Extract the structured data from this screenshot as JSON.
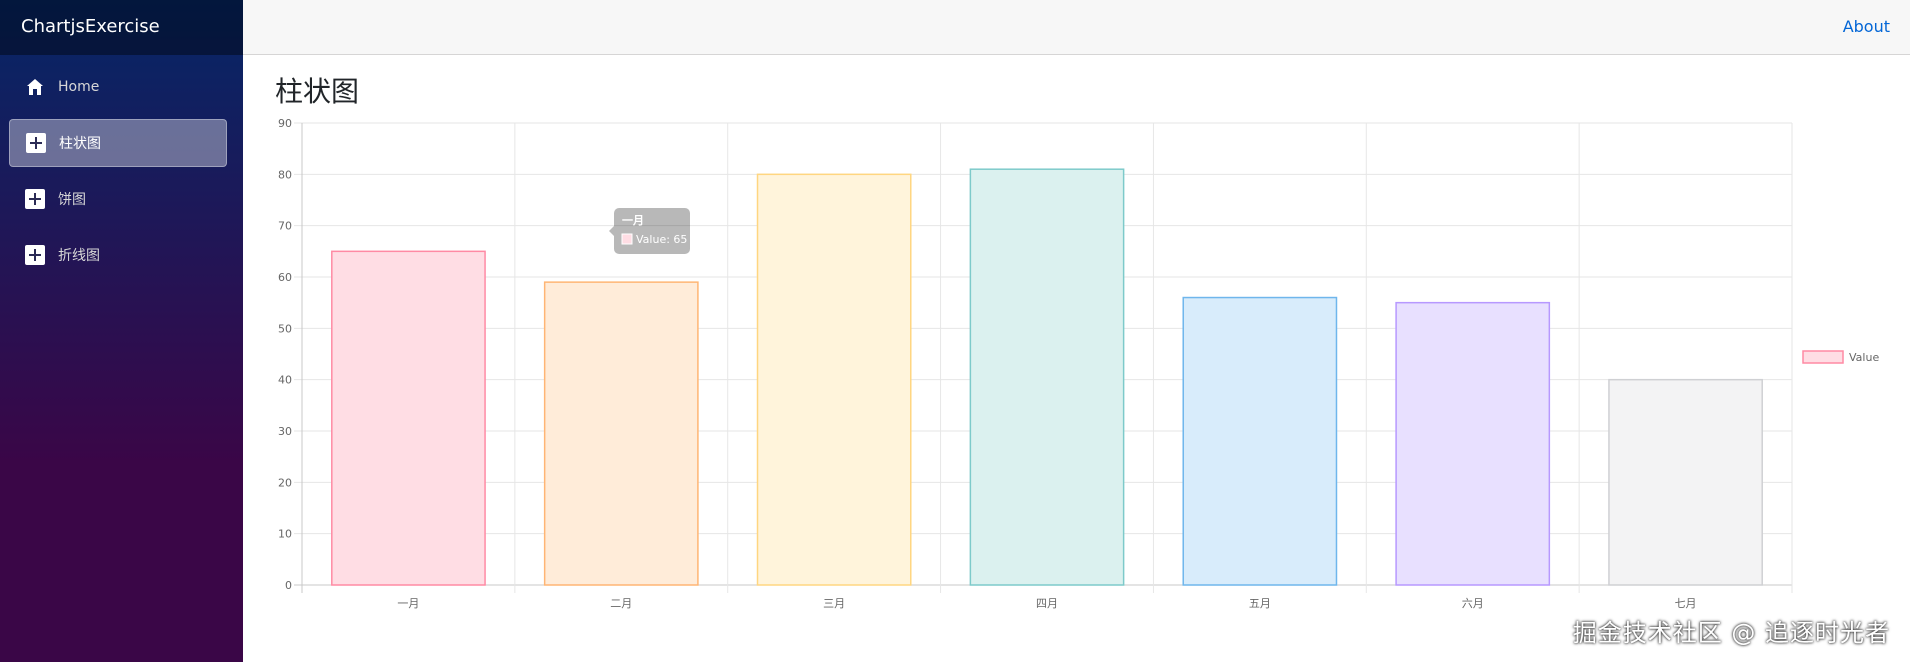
{
  "sidebar": {
    "brand": "ChartjsExercise",
    "items": [
      {
        "label": "Home",
        "icon": "home-icon",
        "active": false
      },
      {
        "label": "柱状图",
        "icon": "plus-square-icon",
        "active": true
      },
      {
        "label": "饼图",
        "icon": "plus-square-icon",
        "active": false
      },
      {
        "label": "折线图",
        "icon": "plus-square-icon",
        "active": false
      }
    ]
  },
  "topbar": {
    "about_label": "About"
  },
  "main": {
    "title": "柱状图"
  },
  "watermark": "掘金技术社区 @ 追逐时光者",
  "chart_data": {
    "type": "bar",
    "categories": [
      "一月",
      "二月",
      "三月",
      "四月",
      "五月",
      "六月",
      "七月"
    ],
    "series": [
      {
        "name": "Value",
        "values": [
          65,
          59,
          80,
          81,
          56,
          55,
          40
        ]
      }
    ],
    "ylim": [
      0,
      90
    ],
    "yticks": [
      0,
      10,
      20,
      30,
      40,
      50,
      60,
      70,
      80,
      90
    ],
    "grid": true,
    "legend_position": "right",
    "bar_fill_colors": [
      "#ffdde4",
      "#ffecd9",
      "#fff4db",
      "#dbf1ef",
      "#d8ecfb",
      "#e8e0ff",
      "#f3f3f4"
    ],
    "bar_border_colors": [
      "#ff8aa4",
      "#ffb574",
      "#ffd680",
      "#7dcaca",
      "#6fb6ec",
      "#b799ff",
      "#cfd0d3"
    ],
    "tooltip": {
      "title": "一月",
      "label": "Value: 65"
    }
  }
}
